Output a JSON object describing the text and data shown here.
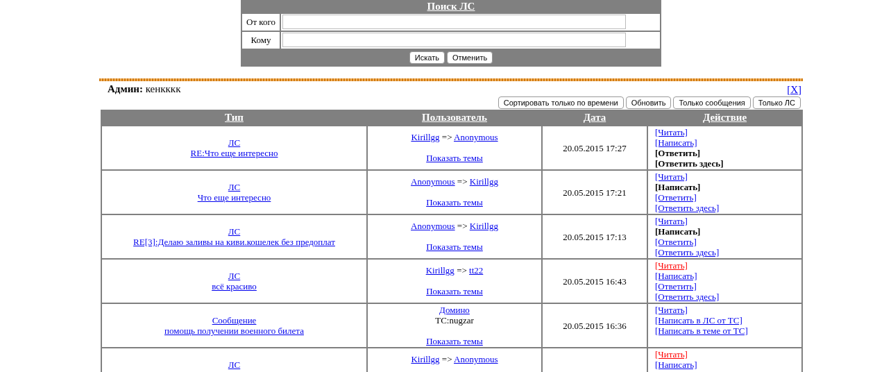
{
  "search": {
    "title": "Поиск ЛС",
    "fields": [
      {
        "label": "От кого"
      },
      {
        "label": "Кому"
      }
    ],
    "buttons": [
      "Искать",
      "Отменить"
    ]
  },
  "close_link": "[X]",
  "admin": {
    "label": "Админ:",
    "name": "кенкккк"
  },
  "toolbar": [
    "Сортировать только по времени",
    "Обновить",
    "Только сообщения",
    "Только ЛС"
  ],
  "table": {
    "columns": [
      "Тип",
      "Пользователь",
      "Дата",
      "Действие"
    ],
    "rows": [
      {
        "type": "ЛС",
        "subject": "RE:Что еще интересно",
        "user": {
          "kind": "pair",
          "from": "Kirillgg",
          "arrow": "=>",
          "to": "Anonymous"
        },
        "show_topics": "Показать темы",
        "date": "20.05.2015 17:27",
        "actions": [
          {
            "label": "[Читать]",
            "kind": "link"
          },
          {
            "label": "[Написать]",
            "kind": "link"
          },
          {
            "label": "[Ответить]",
            "kind": "bold"
          },
          {
            "label": "[Ответить здесь]",
            "kind": "bold"
          }
        ]
      },
      {
        "type": "ЛС",
        "subject": "Что еще интересно",
        "user": {
          "kind": "pair",
          "from": "Anonymous",
          "arrow": "=>",
          "to": "Kirillgg"
        },
        "show_topics": "Показать темы",
        "date": "20.05.2015 17:21",
        "actions": [
          {
            "label": "[Читать]",
            "kind": "link"
          },
          {
            "label": "[Написать]",
            "kind": "bold"
          },
          {
            "label": "[Ответить]",
            "kind": "link"
          },
          {
            "label": "[Ответить здесь]",
            "kind": "link"
          }
        ]
      },
      {
        "type": "ЛС",
        "subject": "RE[3]:Делаю заливы на киви.кошелек без предоплат",
        "user": {
          "kind": "pair",
          "from": "Anonymous",
          "arrow": "=>",
          "to": "Kirillgg"
        },
        "show_topics": "Показать темы",
        "date": "20.05.2015 17:13",
        "actions": [
          {
            "label": "[Читать]",
            "kind": "link"
          },
          {
            "label": "[Написать]",
            "kind": "bold"
          },
          {
            "label": "[Ответить]",
            "kind": "link"
          },
          {
            "label": "[Ответить здесь]",
            "kind": "link"
          }
        ]
      },
      {
        "type": "ЛС",
        "subject": "всё красиво",
        "user": {
          "kind": "pair",
          "from": "Kirillgg",
          "arrow": "=>",
          "to": "tt22"
        },
        "show_topics": "Показать темы",
        "date": "20.05.2015 16:43",
        "actions": [
          {
            "label": "[Читать]",
            "kind": "unread"
          },
          {
            "label": "[Написать]",
            "kind": "link"
          },
          {
            "label": "[Ответить]",
            "kind": "link"
          },
          {
            "label": "[Ответить здесь]",
            "kind": "link"
          }
        ]
      },
      {
        "type": "Сообщение",
        "subject": "помощь получении военного билета",
        "user": {
          "kind": "topic",
          "name": "Домино",
          "tc": "TC:nugzar"
        },
        "show_topics": "Показать темы",
        "date": "20.05.2015 16:36",
        "actions": [
          {
            "label": "[Читать]",
            "kind": "link"
          },
          {
            "label": "[Написать в ЛС от ТС]",
            "kind": "link"
          },
          {
            "label": "[Написать в теме от ТС]",
            "kind": "link"
          }
        ]
      },
      {
        "type": "ЛС",
        "user": {
          "kind": "pair",
          "from": "Kirillgg",
          "arrow": "=>",
          "to": "Anonymous"
        },
        "actions": [
          {
            "label": "[Читать]",
            "kind": "unread"
          },
          {
            "label": "[Написать]",
            "kind": "link"
          }
        ]
      }
    ]
  }
}
